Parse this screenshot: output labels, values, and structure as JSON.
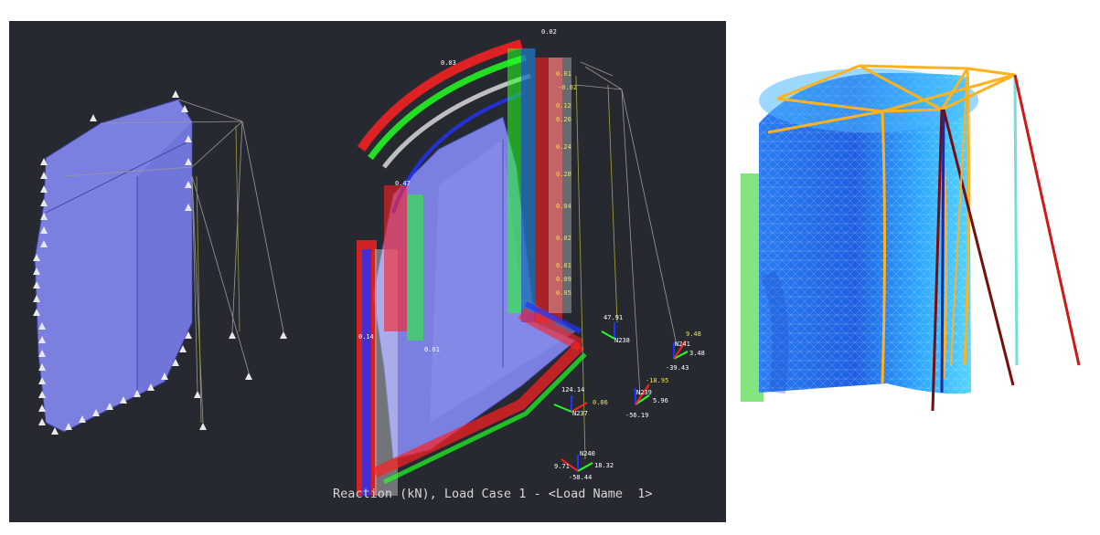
{
  "caption": "Reaction (kN), Load Case 1 - <Load Name  1>",
  "reaction_labels": [
    {
      "id": "n238",
      "node": "N238",
      "value": "47.91"
    },
    {
      "id": "n241",
      "node": "N241",
      "value": "-39.43",
      "value2": "9.48",
      "value3": "3.48"
    },
    {
      "id": "n239",
      "node": "N239",
      "value": "-56.19",
      "value2": "-18.95",
      "value3": "5.96"
    },
    {
      "id": "n237",
      "node": "N237",
      "value": "124.14",
      "value2": "0.06"
    },
    {
      "id": "n240",
      "node": "N240",
      "value": "-58.44",
      "value2": "9.71",
      "value3": "18.32"
    }
  ],
  "top_values": [
    "0.02",
    "0.03",
    "0.01",
    "-0.02",
    "0.26",
    "0.24",
    "0.28",
    "0.04",
    "0.02",
    "0.01",
    "0.12",
    "0.47",
    "0.14",
    "0.01",
    "0.09",
    "0.05"
  ],
  "colors": {
    "viewport_bg": "#262a30",
    "shell": "#7b7fe0",
    "shell_dark": "#5b5fc4",
    "support": "#e6e6e6",
    "arrow_red": "#ff2020",
    "arrow_green": "#22ff22",
    "arrow_blue": "#2233ff",
    "frame_line": "#9a9a9a",
    "mesh_blue": "#1e88ff",
    "beam_yellow": "#ffb21e"
  }
}
